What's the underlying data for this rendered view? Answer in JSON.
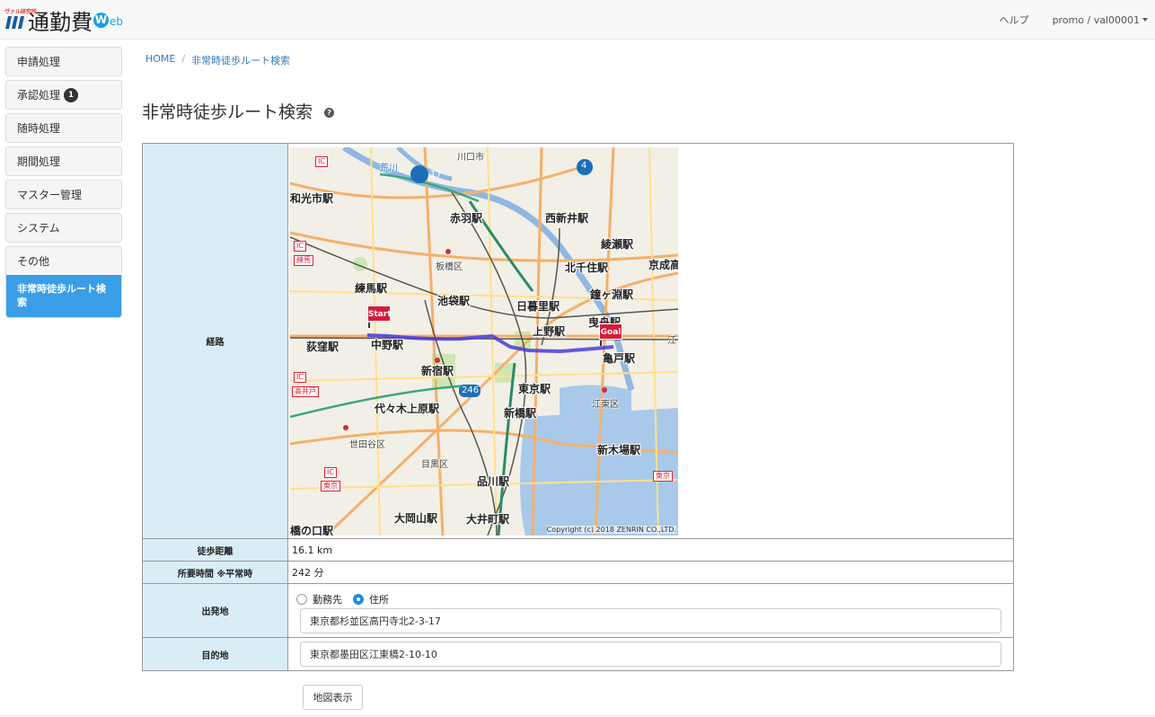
{
  "header": {
    "brand_tag": "ヴァル研究所",
    "brand_title": "通勤費",
    "brand_web_w": "W",
    "brand_web_rest": "eb",
    "help": "ヘルプ",
    "user": "promo / val00001"
  },
  "sidebar": {
    "items": [
      {
        "label": "申請処理"
      },
      {
        "label": "承認処理",
        "badge": "1"
      },
      {
        "label": "随時処理"
      },
      {
        "label": "期間処理"
      },
      {
        "label": "マスター管理"
      },
      {
        "label": "システム"
      }
    ],
    "group": {
      "label": "その他",
      "active": "非常時徒歩ルート検索"
    }
  },
  "breadcrumb": {
    "home": "HOME",
    "sep": "/",
    "current": "非常時徒歩ルート検索"
  },
  "page": {
    "title": "非常時徒歩ルート検索",
    "help_glyph": "?"
  },
  "table": {
    "route_label": "経路",
    "distance_label": "徒歩距離",
    "distance_value": "16.1 km",
    "time_label": "所要時間 ※平常時",
    "time_value": "242 分",
    "origin_label": "出発地",
    "origin_options": [
      "勤務先",
      "住所"
    ],
    "origin_selected": "住所",
    "origin_value": "東京都杉並区高円寺北2-3-17",
    "dest_label": "目的地",
    "dest_value": "東京都墨田区江東橋2-10-10"
  },
  "map": {
    "stations": [
      {
        "t": "和光市駅"
      },
      {
        "t": "赤羽駅"
      },
      {
        "t": "西新井駅"
      },
      {
        "t": "綾瀬駅"
      },
      {
        "t": "北千住駅"
      },
      {
        "t": "京成高"
      },
      {
        "t": "練馬駅"
      },
      {
        "t": "池袋駅"
      },
      {
        "t": "鐘ヶ淵駅"
      },
      {
        "t": "日暮里駅"
      },
      {
        "t": "曳舟駅"
      },
      {
        "t": "上野駅"
      },
      {
        "t": "荻窪駅"
      },
      {
        "t": "中野駅"
      },
      {
        "t": "亀戸駅"
      },
      {
        "t": "新宿駅"
      },
      {
        "t": "東京駅"
      },
      {
        "t": "代々木上原駅"
      },
      {
        "t": "新橋駅"
      },
      {
        "t": "新木場駅"
      },
      {
        "t": "品川駅"
      },
      {
        "t": "大岡山駅"
      },
      {
        "t": "大井町駅"
      },
      {
        "t": "橋の口駅"
      }
    ],
    "wards": [
      {
        "t": "川口市"
      },
      {
        "t": "板橋区"
      },
      {
        "t": "江東区"
      },
      {
        "t": "世田谷区"
      },
      {
        "t": "目黒区"
      }
    ],
    "route_shields": [
      "17",
      "4",
      "246"
    ],
    "river_label": "荒川",
    "ic_labels": [
      "IC",
      "IC",
      "IC",
      "IC"
    ],
    "ic_names": [
      "練馬",
      "高井戸",
      "東京"
    ],
    "edge_labels": [
      "江",
      "東京"
    ],
    "start_pin": "Start",
    "goal_pin": "Goal",
    "copyright": "Copyright (c) 2018 ZENRIN CO.,LTD."
  },
  "actions": {
    "show_map": "地図表示"
  },
  "colors": {
    "accent": "#3a9ee6",
    "route": "#4a3be0",
    "header_bg": "#d9edf7"
  }
}
